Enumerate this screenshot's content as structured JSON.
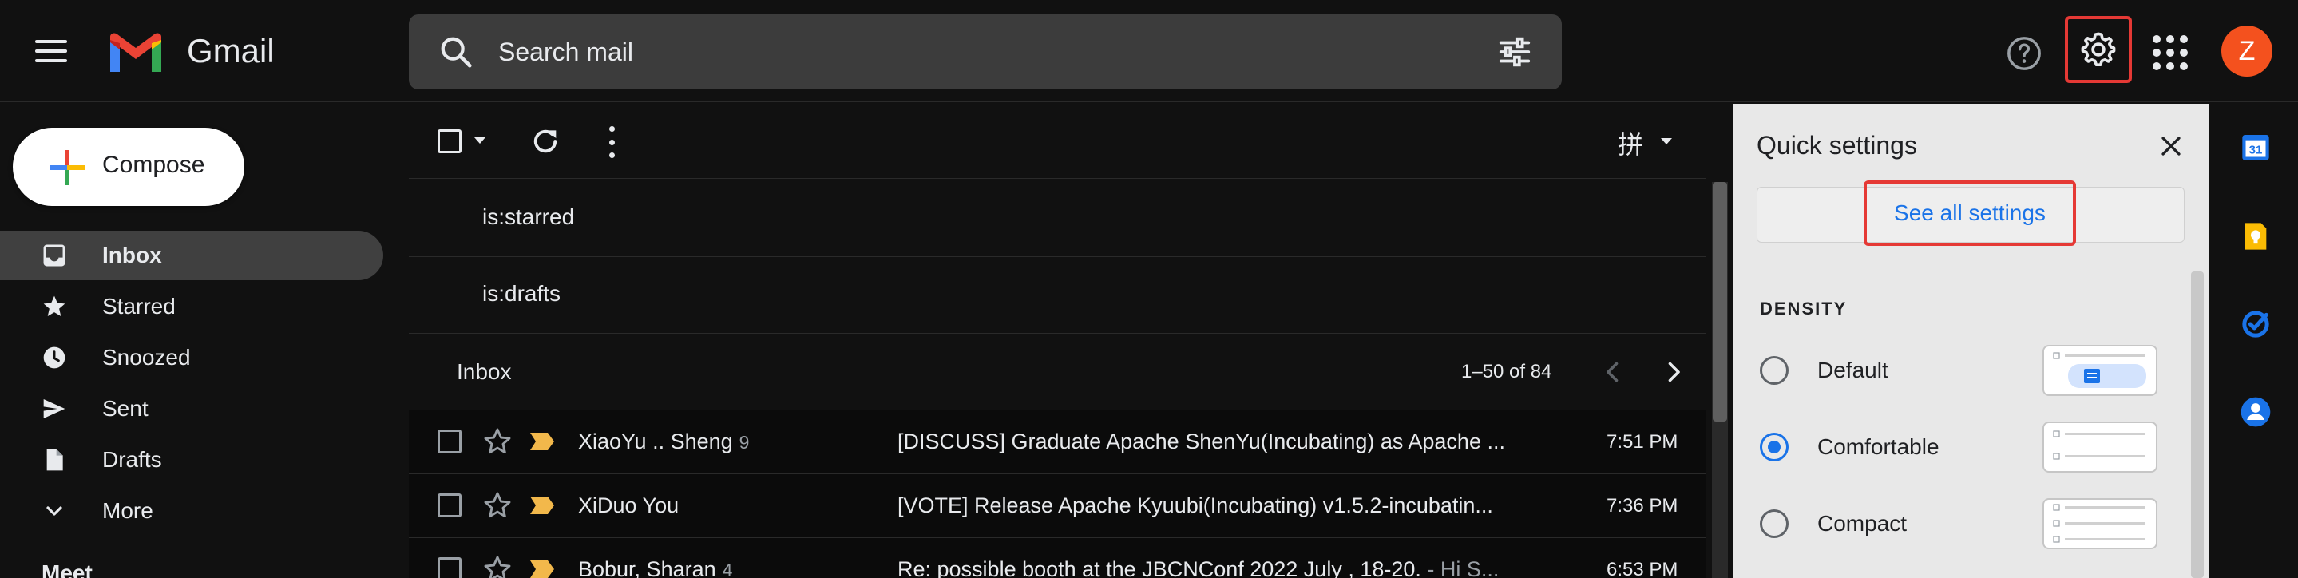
{
  "header": {
    "brand": "Gmail",
    "search_placeholder": "Search mail",
    "avatar_initial": "Z",
    "accent_highlight": "#e53935"
  },
  "sidebar": {
    "compose_label": "Compose",
    "items": [
      {
        "label": "Inbox",
        "icon": "inbox-icon",
        "active": true
      },
      {
        "label": "Starred",
        "icon": "star-icon"
      },
      {
        "label": "Snoozed",
        "icon": "clock-icon"
      },
      {
        "label": "Sent",
        "icon": "send-icon"
      },
      {
        "label": "Drafts",
        "icon": "draft-icon"
      },
      {
        "label": "More",
        "icon": "chevron-down-icon"
      }
    ],
    "meet_label": "Meet"
  },
  "toolbar": {
    "input_tools_glyph": "拼"
  },
  "saved_searches": [
    "is:starred",
    "is:drafts"
  ],
  "inbox": {
    "title": "Inbox",
    "page_range": "1–50 of 84",
    "rows": [
      {
        "sender": "XiaoYu .. Sheng",
        "count": "9",
        "subject": "[DISCUSS] Graduate Apache ShenYu(Incubating) as Apache ...",
        "snippet": "",
        "time": "7:51 PM"
      },
      {
        "sender": "XiDuo You",
        "count": "",
        "subject": "[VOTE] Release Apache Kyuubi(Incubating) v1.5.2-incubatin...",
        "snippet": "",
        "time": "7:36 PM"
      },
      {
        "sender": "Bobur, Sharan",
        "count": "4",
        "subject": "Re: possible booth at the JBCNConf 2022 July , 18-20.",
        "snippet": " - Hi S...",
        "time": "6:53 PM"
      }
    ]
  },
  "quick_settings": {
    "title": "Quick settings",
    "see_all": "See all settings",
    "density_heading": "DENSITY",
    "density_options": [
      {
        "label": "Default",
        "selected": false
      },
      {
        "label": "Comfortable",
        "selected": true
      },
      {
        "label": "Compact",
        "selected": false
      }
    ]
  },
  "right_rail": {
    "icons": [
      "calendar-icon",
      "keep-icon",
      "tasks-icon",
      "contacts-icon"
    ]
  }
}
